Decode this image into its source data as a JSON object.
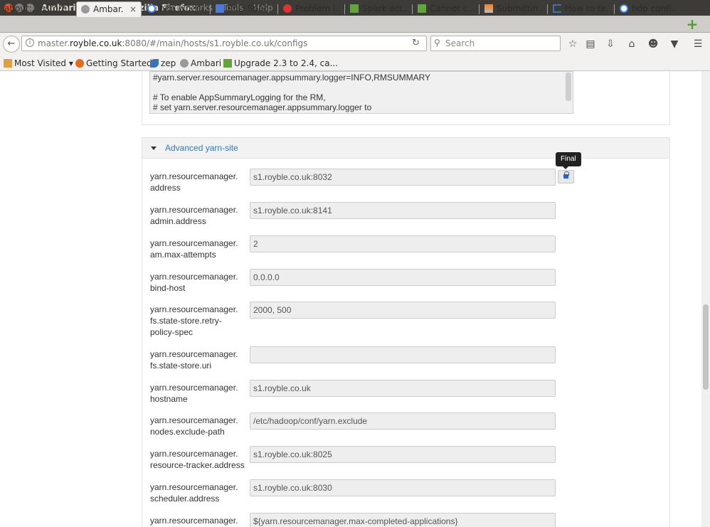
{
  "window": {
    "title": "Ambari - cresta - Mozilla Firefox",
    "menu": [
      "Bookmarks",
      "Tools",
      "Help"
    ]
  },
  "tabs": [
    {
      "label": "about:...estore",
      "icon": "firefox-icon",
      "active": false
    },
    {
      "label": "Ambar...",
      "icon": "ambari-icon",
      "active": true
    },
    {
      "label": "hdp wher...",
      "icon": "google-icon",
      "active": false
    },
    {
      "label": "PhD Spar...",
      "icon": "docs-icon",
      "active": false
    },
    {
      "label": "Problem l...",
      "icon": "stop-icon",
      "active": false
    },
    {
      "label": "Spark act...",
      "icon": "upgrade-icon",
      "active": false
    },
    {
      "label": "Cannot c...",
      "icon": "upgrade-icon",
      "active": false
    },
    {
      "label": "Submittin...",
      "icon": "stackoverflow-icon",
      "active": false
    },
    {
      "label": "How to te...",
      "icon": "bracket-icon",
      "active": false
    },
    {
      "label": "hdp confi...",
      "icon": "google-icon",
      "active": false
    }
  ],
  "nav": {
    "url_prefix": "master.",
    "url_host": "royble.co.uk",
    "url_rest": ":8080/#/main/hosts/s1.royble.co.uk/configs",
    "search_placeholder": "Search"
  },
  "bookmarks": [
    {
      "label": "Most Visited ▾",
      "icon": "folder-icon"
    },
    {
      "label": "Getting Started",
      "icon": "firefox-icon"
    },
    {
      "label": "zep",
      "icon": "zeppelin-icon"
    },
    {
      "label": "Ambari",
      "icon": "ambari-icon"
    },
    {
      "label": "Upgrade 2.3 to 2.4, ca...",
      "icon": "upgrade-icon"
    }
  ],
  "textarea_text": "#yarn.server.resourcemanager.appsummary.logger=INFO,RMSUMMARY\n\n# To enable AppSummaryLogging for the RM,\n# set yarn.server.resourcemanager.appsummary.logger to",
  "section": {
    "title": "Advanced yarn-site",
    "tooltip": "Final"
  },
  "properties": [
    {
      "label": "yarn.resourcemanager.\naddress",
      "value": "s1.royble.co.uk:8032"
    },
    {
      "label": "yarn.resourcemanager.\nadmin.address",
      "value": "s1.royble.co.uk:8141"
    },
    {
      "label": "yarn.resourcemanager.\nam.max-attempts",
      "value": "2"
    },
    {
      "label": "yarn.resourcemanager.\nbind-host",
      "value": "0.0.0.0"
    },
    {
      "label": "yarn.resourcemanager.\nfs.state-store.retry-\npolicy-spec",
      "value": "2000, 500"
    },
    {
      "label": "yarn.resourcemanager.\nfs.state-store.uri",
      "value": ""
    },
    {
      "label": "yarn.resourcemanager.\nhostname",
      "value": "s1.royble.co.uk"
    },
    {
      "label": "yarn.resourcemanager.\nnodes.exclude-path",
      "value": "/etc/hadoop/conf/yarn.exclude"
    },
    {
      "label": "yarn.resourcemanager.\nresource-tracker.address",
      "value": "s1.royble.co.uk:8025"
    },
    {
      "label": "yarn.resourcemanager.\nscheduler.address",
      "value": "s1.royble.co.uk:8030"
    },
    {
      "label": "yarn.resourcemanager.",
      "value": "${yarn.resourcemanager.max-completed-applications}"
    }
  ]
}
